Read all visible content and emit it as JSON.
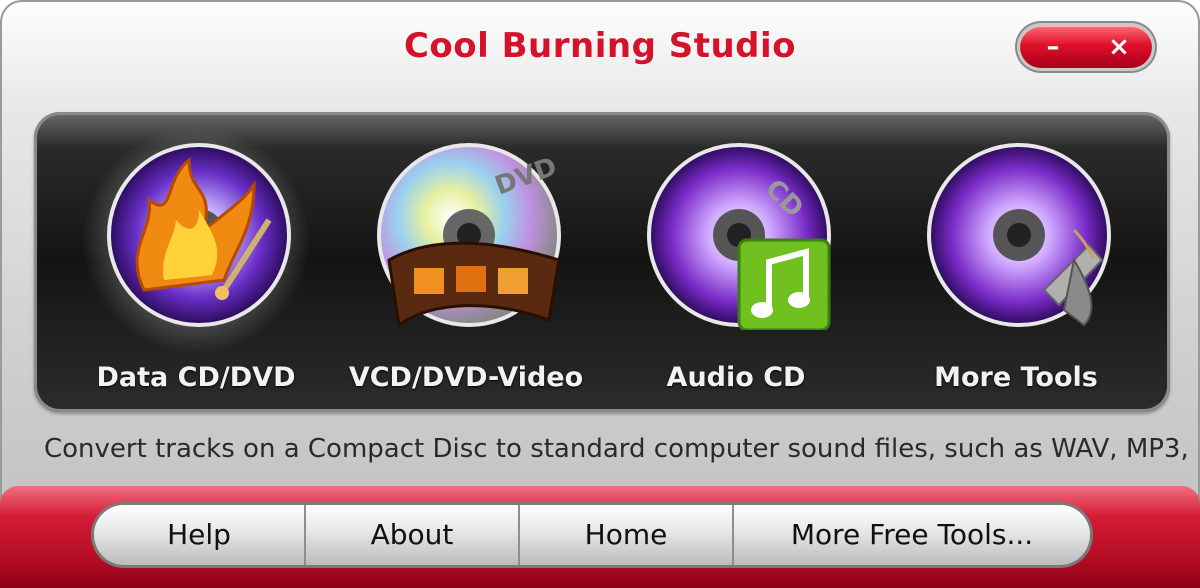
{
  "window": {
    "title": "Cool Burning Studio",
    "minimize_glyph": "–",
    "close_glyph": "×"
  },
  "tools": [
    {
      "label": "Data CD/DVD",
      "icon": "data-disc-flame-icon"
    },
    {
      "label": "VCD/DVD-Video",
      "icon": "video-disc-film-icon"
    },
    {
      "label": "Audio CD",
      "icon": "audio-disc-music-icon"
    },
    {
      "label": "More Tools",
      "icon": "tools-disc-icon"
    }
  ],
  "status_text": "Convert tracks on a Compact Disc to standard computer sound files, such as WAV, MP3, ",
  "footer_buttons": {
    "help": "Help",
    "about": "About",
    "home": "Home",
    "more_free_tools": "More Free Tools..."
  },
  "colors": {
    "title": "#d4122a",
    "accent_red": "#c81028",
    "panel_bg": "#1a1a1a"
  }
}
